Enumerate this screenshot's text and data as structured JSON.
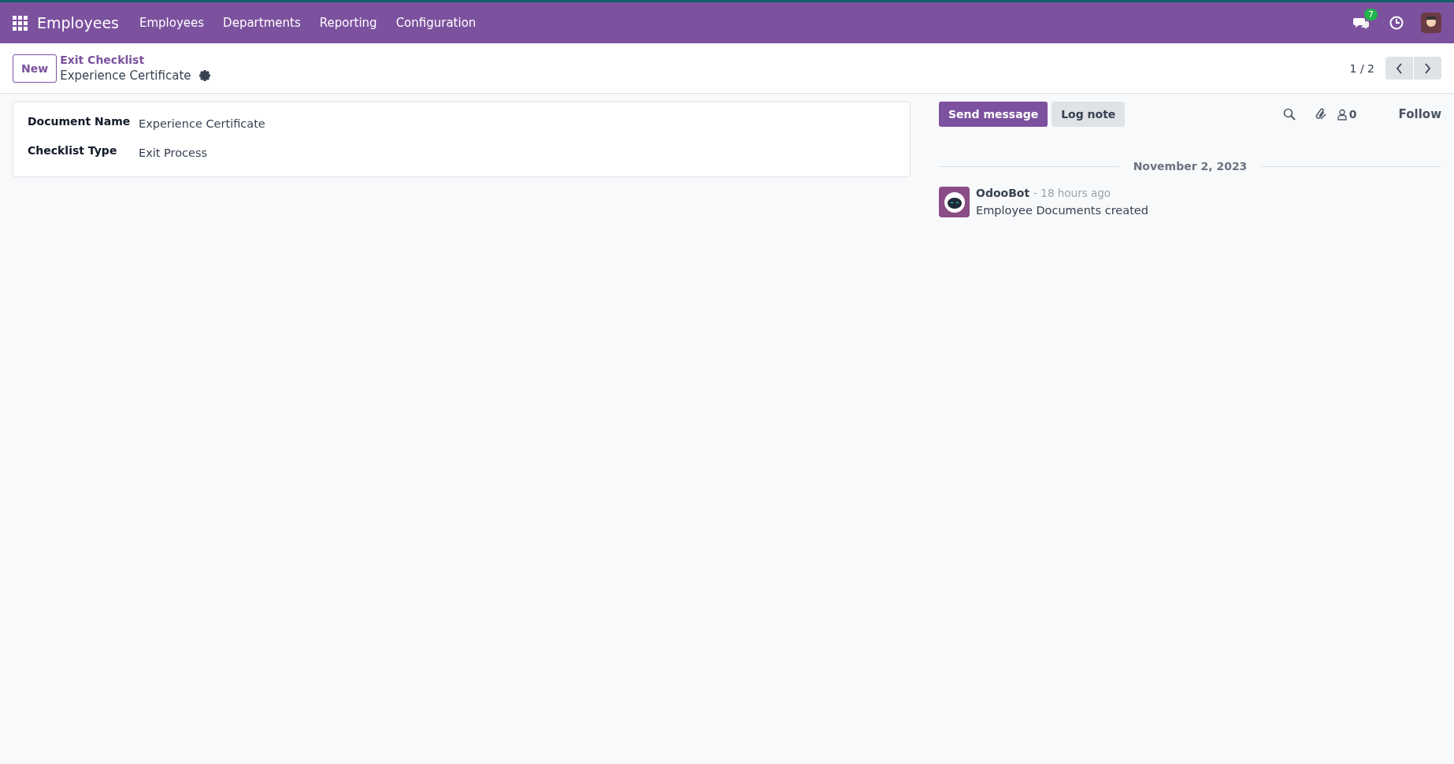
{
  "navbar": {
    "app_name": "Employees",
    "menu": [
      "Employees",
      "Departments",
      "Reporting",
      "Configuration"
    ],
    "messages_badge": "7"
  },
  "control_panel": {
    "new_button": "New",
    "breadcrumb": "Exit Checklist",
    "record_title": "Experience Certificate",
    "pager": "1 / 2"
  },
  "form": {
    "fields": [
      {
        "label": "Document Name",
        "value": "Experience Certificate"
      },
      {
        "label": "Checklist Type",
        "value": "Exit Process"
      }
    ]
  },
  "chatter": {
    "send_message": "Send message",
    "log_note": "Log note",
    "followers_count": "0",
    "follow": "Follow",
    "date_separator": "November 2, 2023",
    "messages": [
      {
        "author": "OdooBot",
        "time": "- 18 hours ago",
        "body": "Employee Documents created"
      }
    ]
  }
}
